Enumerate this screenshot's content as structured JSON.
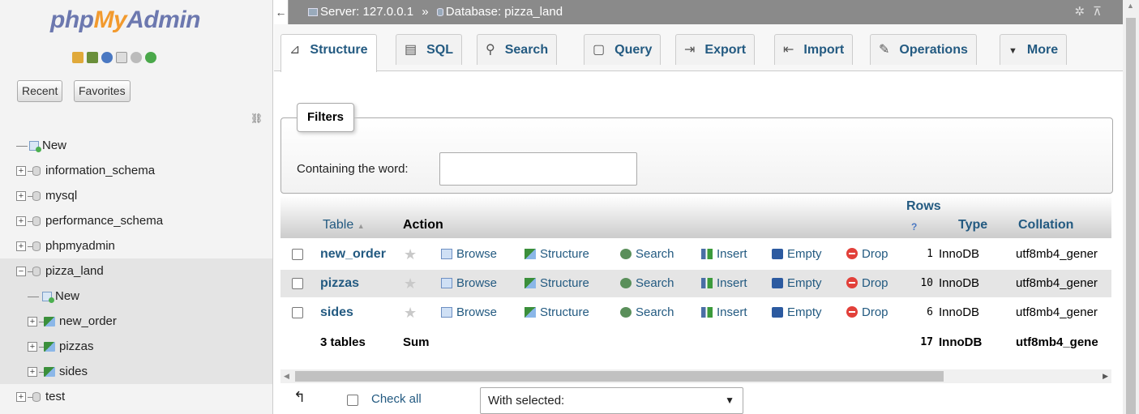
{
  "nav": {
    "logo": {
      "php": "php",
      "my": "My",
      "admin": "Admin"
    },
    "recent_label": "Recent",
    "favorites_label": "Favorites",
    "tree": [
      {
        "label": "New",
        "type": "new"
      },
      {
        "label": "information_schema",
        "type": "db"
      },
      {
        "label": "mysql",
        "type": "db"
      },
      {
        "label": "performance_schema",
        "type": "db"
      },
      {
        "label": "phpmyadmin",
        "type": "db"
      },
      {
        "label": "pizza_land",
        "type": "db",
        "selected": true
      },
      {
        "label": "New",
        "type": "new-child"
      },
      {
        "label": "new_order",
        "type": "table"
      },
      {
        "label": "pizzas",
        "type": "table"
      },
      {
        "label": "sides",
        "type": "table"
      },
      {
        "label": "test",
        "type": "db"
      }
    ]
  },
  "topbar": {
    "server": "Server: 127.0.0.1",
    "separator": "»",
    "database": "Database: pizza_land"
  },
  "tabs": [
    {
      "label": "Structure",
      "icon": "structure-icon",
      "glyph": "⊿"
    },
    {
      "label": "SQL",
      "icon": "sql-icon",
      "glyph": "▤"
    },
    {
      "label": "Search",
      "icon": "search-icon",
      "glyph": "⚲"
    },
    {
      "label": "Query",
      "icon": "query-icon",
      "glyph": "▢"
    },
    {
      "label": "Export",
      "icon": "export-icon",
      "glyph": "⇥"
    },
    {
      "label": "Import",
      "icon": "import-icon",
      "glyph": "⇤"
    },
    {
      "label": "Operations",
      "icon": "wrench-icon",
      "glyph": "✎"
    },
    {
      "label": "More",
      "icon": "triangle-down-icon",
      "glyph": "▼"
    }
  ],
  "filters": {
    "legend": "Filters",
    "label": "Containing the word:",
    "value": ""
  },
  "table": {
    "headers": {
      "table": "Table",
      "action": "Action",
      "rows": "Rows",
      "type": "Type",
      "collation": "Collation"
    },
    "actions": {
      "browse": "Browse",
      "structure": "Structure",
      "search": "Search",
      "insert": "Insert",
      "empty": "Empty",
      "drop": "Drop"
    },
    "rows": [
      {
        "name": "new_order",
        "rows": "1",
        "type": "InnoDB",
        "collation": "utf8mb4_gener"
      },
      {
        "name": "pizzas",
        "rows": "10",
        "type": "InnoDB",
        "collation": "utf8mb4_gener"
      },
      {
        "name": "sides",
        "rows": "6",
        "type": "InnoDB",
        "collation": "utf8mb4_gener"
      }
    ],
    "summary": {
      "count": "3 tables",
      "sum": "Sum",
      "rows": "17",
      "type": "InnoDB",
      "collation": "utf8mb4_gene"
    }
  },
  "bottom": {
    "check_all": "Check all",
    "with_selected": "With selected:"
  },
  "colors": {
    "link": "#235a81",
    "topbar": "#8a8a8a",
    "drop": "#e2403a"
  }
}
